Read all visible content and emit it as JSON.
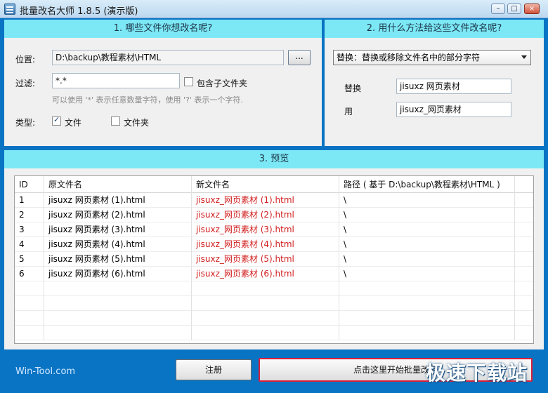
{
  "window": {
    "title": "批量改名大师 1.8.5 (演示版)",
    "min_glyph": "–",
    "max_glyph": "□",
    "close_glyph": "×"
  },
  "section1": {
    "header": "1. 哪些文件你想改名呢?",
    "location_label": "位置:",
    "location_value": "D:\\backup\\教程素材\\HTML",
    "browse_label": "...",
    "filter_label": "过滤:",
    "filter_value": "*.*",
    "include_subfolders_label": "包含子文件夹",
    "include_subfolders_checked": false,
    "hint": "可以使用 '*' 表示任意数量字符，使用 '?' 表示一个字符.",
    "type_label": "类型:",
    "type_file_label": "文件",
    "type_file_checked": true,
    "type_folder_label": "文件夹",
    "type_folder_checked": false
  },
  "section2": {
    "header": "2. 用什么方法给这些文件改名呢?",
    "method_selected": "替换：替换或移除文件名中的部分字符",
    "replace_label": "替换",
    "replace_value": "jisuxz 网页素材",
    "with_label": "用",
    "with_value": "jisuxz_网页素材"
  },
  "section3": {
    "header": "3. 预览",
    "columns": {
      "id": "ID",
      "original": "原文件名",
      "new": "新文件名",
      "path": "路径 ( 基于 D:\\backup\\教程素材\\HTML )"
    },
    "rows": [
      {
        "id": "1",
        "original": "jisuxz 网页素材 (1).html",
        "new": "jisuxz_网页素材 (1).html",
        "path": "\\"
      },
      {
        "id": "2",
        "original": "jisuxz 网页素材 (2).html",
        "new": "jisuxz_网页素材 (2).html",
        "path": "\\"
      },
      {
        "id": "3",
        "original": "jisuxz 网页素材 (3).html",
        "new": "jisuxz_网页素材 (3).html",
        "path": "\\"
      },
      {
        "id": "4",
        "original": "jisuxz 网页素材 (4).html",
        "new": "jisuxz_网页素材 (4).html",
        "path": "\\"
      },
      {
        "id": "5",
        "original": "jisuxz 网页素材 (5).html",
        "new": "jisuxz_网页素材 (5).html",
        "path": "\\"
      },
      {
        "id": "6",
        "original": "jisuxz 网页素材 (6).html",
        "new": "jisuxz_网页素材 (6).html",
        "path": "\\"
      }
    ]
  },
  "footer": {
    "link": "Win-Tool.com",
    "register_label": "注册",
    "start_label": "点击这里开始批量改名",
    "watermark": "极速下载站"
  },
  "colors": {
    "header_bg": "#7de8f5",
    "footer_bg": "#0a74c4",
    "new_name_text": "#d21e1e",
    "start_border": "#d8203a"
  }
}
